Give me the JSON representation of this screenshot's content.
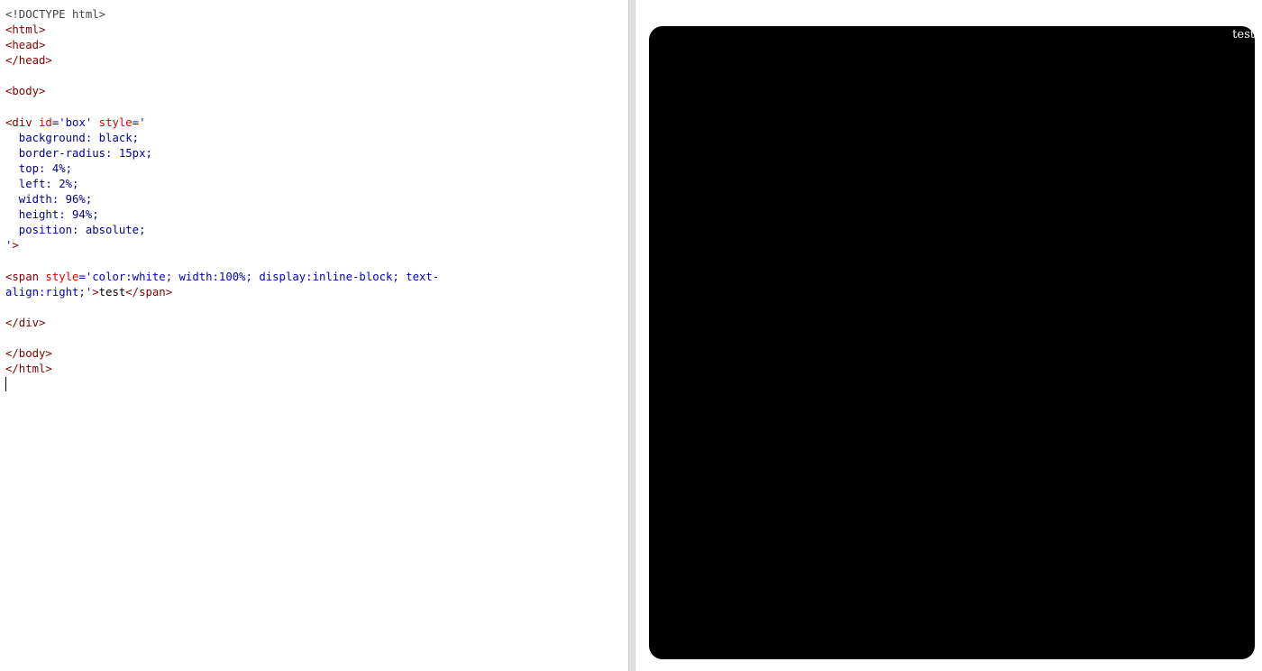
{
  "editor": {
    "lines": [
      [
        {
          "c": "t-doc",
          "t": "<!DOCTYPE html>"
        }
      ],
      [
        {
          "c": "t-tag",
          "t": "<html>"
        }
      ],
      [
        {
          "c": "t-tag",
          "t": "<head>"
        }
      ],
      [
        {
          "c": "t-tag",
          "t": "</head>"
        }
      ],
      [],
      [
        {
          "c": "t-tag",
          "t": "<body>"
        }
      ],
      [],
      [
        {
          "c": "t-tag",
          "t": "<div "
        },
        {
          "c": "t-attr",
          "t": "id"
        },
        {
          "c": "t-prop",
          "t": "="
        },
        {
          "c": "t-val",
          "t": "'box'"
        },
        {
          "c": "t-attr",
          "t": " style"
        },
        {
          "c": "t-prop",
          "t": "='"
        }
      ],
      [
        {
          "c": "t-prop",
          "t": "  background: black;"
        }
      ],
      [
        {
          "c": "t-prop",
          "t": "  border-radius: 15px;"
        }
      ],
      [
        {
          "c": "t-prop",
          "t": "  top: 4%;"
        }
      ],
      [
        {
          "c": "t-prop",
          "t": "  left: 2%;"
        }
      ],
      [
        {
          "c": "t-prop",
          "t": "  width: 96%;"
        }
      ],
      [
        {
          "c": "t-prop",
          "t": "  height: 94%;"
        }
      ],
      [
        {
          "c": "t-prop",
          "t": "  position: absolute;"
        }
      ],
      [
        {
          "c": "t-val",
          "t": "'"
        },
        {
          "c": "t-tag",
          "t": ">"
        }
      ],
      [],
      [
        {
          "c": "t-tag",
          "t": "<span "
        },
        {
          "c": "t-attr",
          "t": "style"
        },
        {
          "c": "t-prop",
          "t": "="
        },
        {
          "c": "t-val",
          "t": "'color:white; width:100%; display:inline-block; text-"
        }
      ],
      [
        {
          "c": "t-val",
          "t": "align:right;'"
        },
        {
          "c": "t-tag",
          "t": ">"
        },
        {
          "c": "t-text",
          "t": "test"
        },
        {
          "c": "t-tag",
          "t": "</span>"
        }
      ],
      [],
      [
        {
          "c": "t-tag",
          "t": "</div>"
        }
      ],
      [],
      [
        {
          "c": "t-tag",
          "t": "</body>"
        }
      ],
      [
        {
          "c": "t-tag",
          "t": "</html>"
        }
      ]
    ]
  },
  "preview": {
    "box_text": "test",
    "box_color": "#000000",
    "text_color": "#ffffff"
  }
}
